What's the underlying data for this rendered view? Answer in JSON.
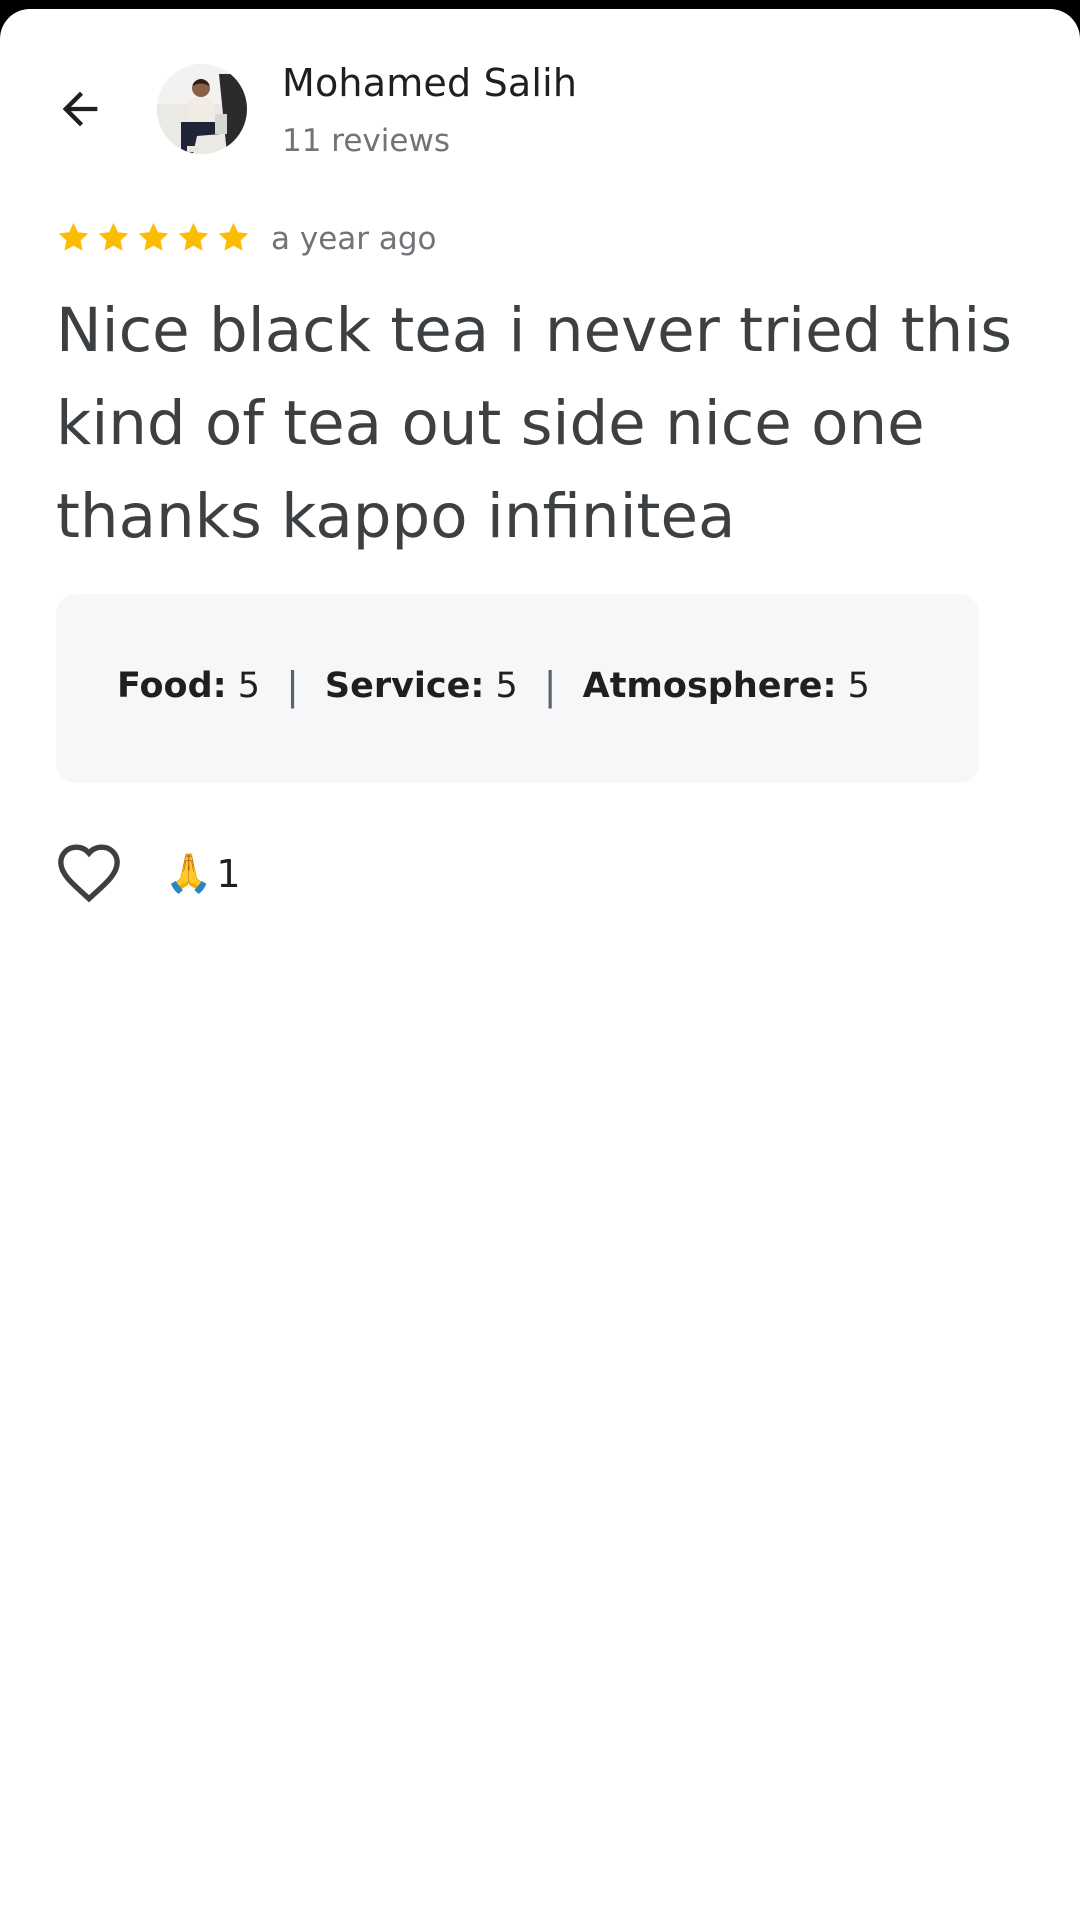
{
  "header": {
    "author_name": "Mohamed Salih",
    "author_meta": "11 reviews"
  },
  "review": {
    "rating": 5,
    "rating_max": 5,
    "time": "a year ago",
    "text": "Nice black tea i never tried this kind of tea out side nice one thanks kappo infinitea"
  },
  "ratings": [
    {
      "label": "Food:",
      "value": "5"
    },
    {
      "label": "Service:",
      "value": "5"
    },
    {
      "label": "Atmosphere:",
      "value": "5"
    }
  ],
  "actions": {
    "reaction_emoji": "🙏",
    "reaction_count": "1"
  },
  "colors": {
    "star": "#fbbc04",
    "box_bg": "#f6f7f9",
    "text_secondary": "#707377"
  },
  "icons": {
    "back": "arrow-left-icon",
    "like": "heart-outline-icon",
    "star": "star-icon"
  }
}
